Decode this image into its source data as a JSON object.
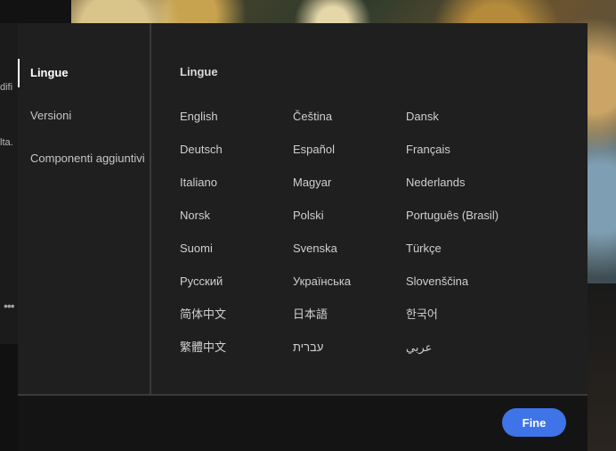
{
  "background": {
    "snippets": [
      "difi",
      "lta."
    ],
    "dots": "•••"
  },
  "dialog": {
    "sidebar": {
      "items": [
        {
          "label": "Lingue",
          "active": true
        },
        {
          "label": "Versioni",
          "active": false
        },
        {
          "label": "Componenti aggiuntivi",
          "active": false
        }
      ]
    },
    "section_title": "Lingue",
    "languages": [
      "English",
      "Čeština",
      "Dansk",
      "Deutsch",
      "Español",
      "Français",
      "Italiano",
      "Magyar",
      "Nederlands",
      "Norsk",
      "Polski",
      "Português (Brasil)",
      "Suomi",
      "Svenska",
      "Türkçe",
      "Русский",
      "Українська",
      "Slovenščina",
      "简体中文",
      "日本語",
      "한국어",
      "繁體中文",
      "עברית",
      "عربي"
    ],
    "footer": {
      "done_label": "Fine"
    },
    "colors": {
      "accent": "#3f73e8",
      "surface": "#1f1f1f"
    }
  }
}
